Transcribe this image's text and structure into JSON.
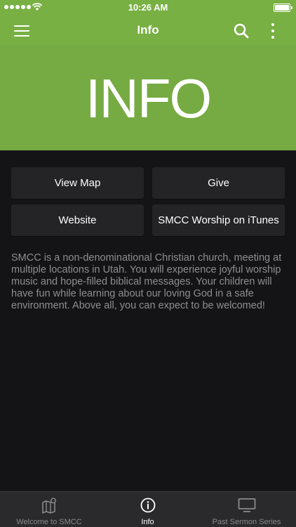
{
  "status_bar": {
    "time": "10:26 AM"
  },
  "app_bar": {
    "title": "Info"
  },
  "banner": {
    "text": "INFO"
  },
  "buttons": {
    "view_map": "View Map",
    "give": "Give",
    "website": "Website",
    "itunes": "SMCC Worship on iTunes"
  },
  "description": "SMCC is a non-denominational Christian church, meeting at multiple locations in Utah. You will experience joyful worship music and hope-filled biblical messages. Your children will have fun while learning about our loving God in a safe environment. Above all, you can expect to be welcomed!",
  "tabs": [
    {
      "label": "Welcome to SMCC",
      "icon": "map-icon",
      "active": false
    },
    {
      "label": "Info",
      "icon": "info-icon",
      "active": true
    },
    {
      "label": "Past Sermon Series",
      "icon": "monitor-icon",
      "active": false
    }
  ],
  "colors": {
    "accent": "#78b043",
    "background": "#141416",
    "button": "#242427",
    "tab_bar": "#2a2a2d"
  }
}
